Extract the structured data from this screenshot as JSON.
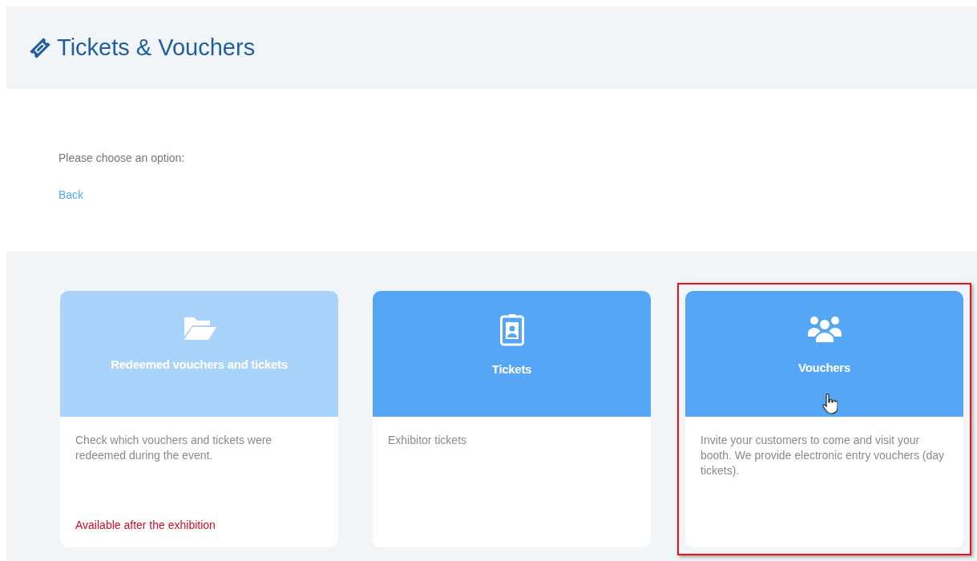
{
  "page": {
    "title": "Tickets & Vouchers"
  },
  "intro": {
    "prompt": "Please choose an option:",
    "back_link": "Back"
  },
  "options": [
    {
      "kind": "folder",
      "title": "Redeemed vouchers and tickets",
      "description": "Check which vouchers and tickets were redeemed during the event.",
      "note": "Available after the exhibition",
      "disabled": true,
      "highlighted": false
    },
    {
      "kind": "badge",
      "title": "Tickets",
      "description": "Exhibitor tickets",
      "disabled": false,
      "highlighted": false
    },
    {
      "kind": "group",
      "title": "Vouchers",
      "description": "Invite your customers to come and visit your booth. We provide electronic entry vouchers (day tickets).",
      "disabled": false,
      "highlighted": true
    }
  ]
}
